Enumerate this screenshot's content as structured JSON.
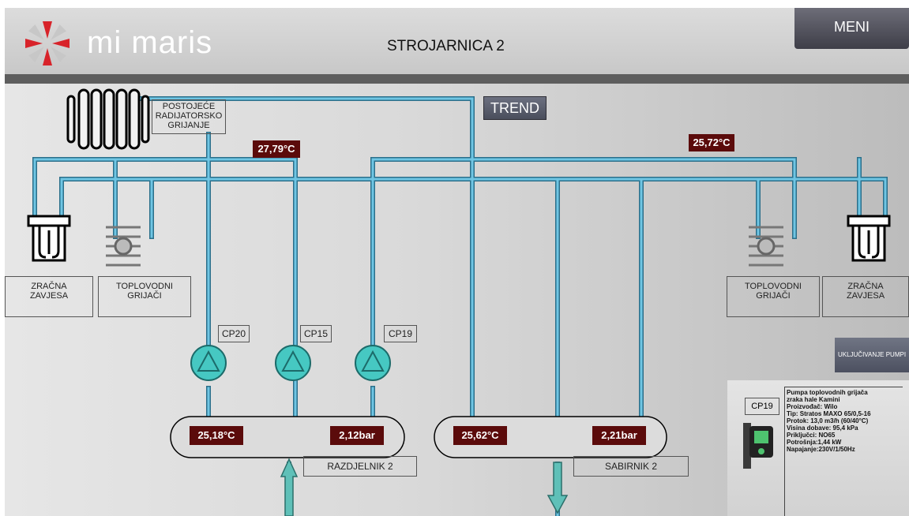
{
  "app": {
    "logo_text": "mi maris",
    "title": "STROJARNICA 2"
  },
  "buttons": {
    "menu": "MENI",
    "trend": "TREND",
    "pump_on": "UKLJUČIVANJE PUMPI"
  },
  "labels": {
    "radiator": "POSTOJEĆE\nRADIJATORSKO\nGRIJANJE",
    "air_curtain_left": "ZRAČNA\nZAVJESA",
    "heaters_left": "TOPLOVODNI\nGRIJAČI",
    "heaters_right": "TOPLOVODNI\nGRIJAČI",
    "air_curtain_right": "ZRAČNA\nZAVJESA",
    "cp20": "CP20",
    "cp15": "CP15",
    "cp19": "CP19",
    "distributor": "RAZDJELNIK 2",
    "collector": "SABIRNIK 2"
  },
  "values": {
    "temp_supply_left": "27,79°C",
    "temp_supply_right": "25,72°C",
    "distributor_temp": "25,18°C",
    "distributor_pressure": "2,12bar",
    "collector_temp": "25,62°C",
    "collector_pressure": "2,21bar"
  },
  "info_panel": {
    "tag": "CP19",
    "text": "Pumpa toplovodnih grijača\nzraka hale Kamini\nProizvođač: Wilo\nTip: Stratos MAXO 65/0,5-16\nProtok: 13,0 m3/h (60/40°C)\nVisina dobave: 95,4 kPa\nPriključci: NO65\nPotrošnja:1,44 kW\nNapajanje:230V/1/50Hz"
  },
  "colors": {
    "pipe": "#5fb8d8",
    "pipe_edge": "#2b6f8a",
    "value_bg": "#5b0b0b",
    "pump": "#46c8c2"
  }
}
